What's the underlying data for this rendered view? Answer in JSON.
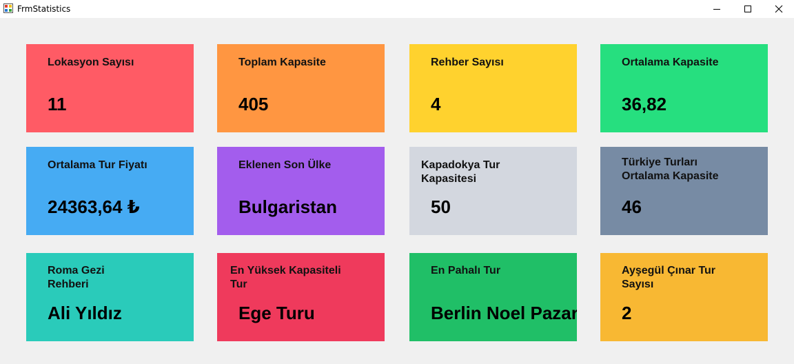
{
  "window": {
    "title": "FrmStatistics",
    "controls": {
      "minimize": "minimize-icon",
      "maximize": "maximize-icon",
      "close": "close-icon"
    }
  },
  "cards": [
    {
      "id": "lokasyon",
      "title": "Lokasyon Sayısı",
      "value": "11",
      "color": "#ff5b65"
    },
    {
      "id": "toplam-kapasite",
      "title": "Toplam Kapasite",
      "value": "405",
      "color": "#ff9641"
    },
    {
      "id": "rehber",
      "title": "Rehber Sayısı",
      "value": "4",
      "color": "#ffd22e"
    },
    {
      "id": "ortalama-kapasite",
      "title": "Ortalama Kapasite",
      "value": "36,82",
      "color": "#26df7f"
    },
    {
      "id": "ortalama-fiyat",
      "title": "Ortalama Tur Fiyatı",
      "value": "24363,64 ₺",
      "color": "#46abf3"
    },
    {
      "id": "son-ulke",
      "title": "Eklenen Son Ülke",
      "value": "Bulgaristan",
      "color": "#a35ded"
    },
    {
      "id": "kapadokya",
      "title": "Kapadokya Tur\nKapasitesi",
      "value": "50",
      "color": "#d3d7df"
    },
    {
      "id": "turkiye",
      "title": "Türkiye Turları\nOrtalama Kapasite",
      "value": "46",
      "color": "#778ba4"
    },
    {
      "id": "roma-rehber",
      "title": "Roma Gezi\nRehberi",
      "value": "Ali Yıldız",
      "color": "#2acbba"
    },
    {
      "id": "yuksek-kapasite",
      "title": "En Yüksek Kapasiteli\nTur",
      "value": "Ege Turu",
      "color": "#ef3a5c"
    },
    {
      "id": "pahali-tur",
      "title": "En Pahalı Tur",
      "value": "Berlin Noel Pazarı",
      "color": "#20bf67"
    },
    {
      "id": "aysegul",
      "title": "Ayşegül Çınar Tur\nSayısı",
      "value": "2",
      "color": "#f8b833"
    }
  ]
}
